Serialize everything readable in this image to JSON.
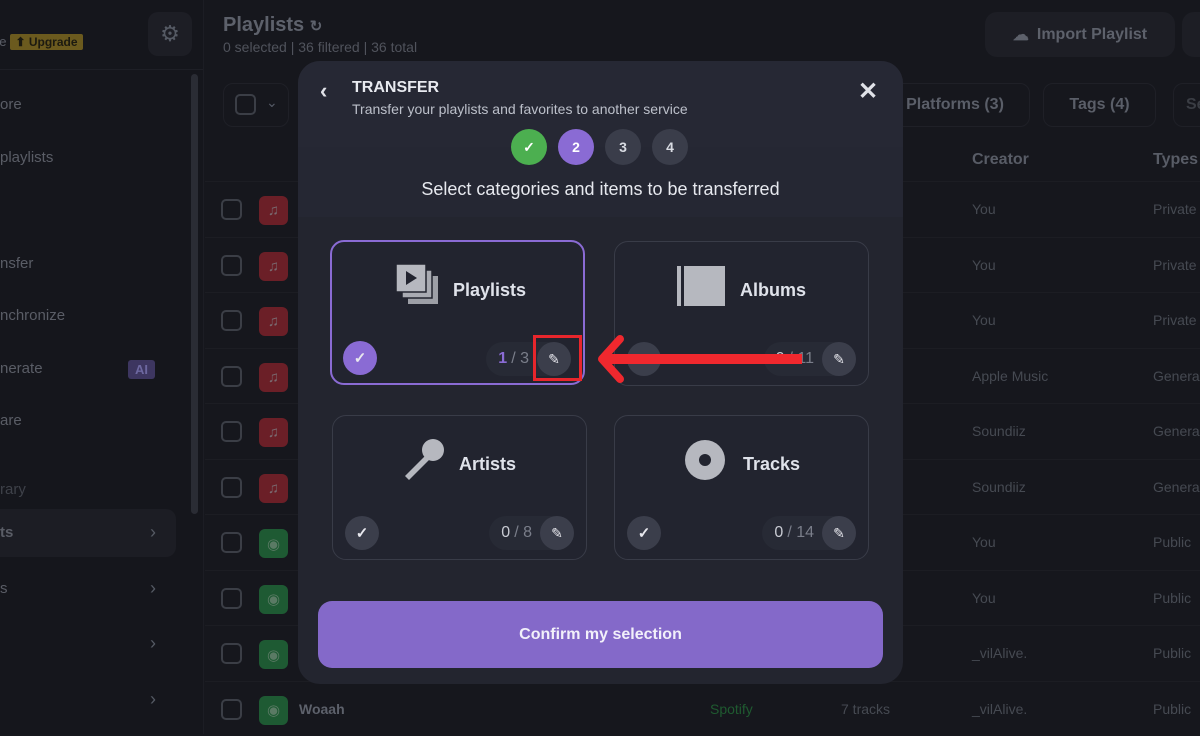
{
  "sidebar": {
    "plan": "ee",
    "upgrade": "Upgrade",
    "items": [
      {
        "label": "ore"
      },
      {
        "label": "playlists"
      },
      {
        "label": "nsfer"
      },
      {
        "label": "nchronize"
      },
      {
        "label": "nerate",
        "badge": "AI"
      },
      {
        "label": "are"
      }
    ],
    "section": "rary",
    "library": [
      {
        "label": "ts"
      },
      {
        "label": "s"
      },
      {
        "label": ""
      },
      {
        "label": ""
      }
    ]
  },
  "header": {
    "title": "Playlists",
    "subtitle": "0 selected | 36 filtered | 36 total",
    "import": "Import Playlist"
  },
  "filters": {
    "platforms": "Platforms (3)",
    "tags": "Tags (4)",
    "search": "Se"
  },
  "table": {
    "columns": {
      "creator": "Creator",
      "types": "Types"
    },
    "rows": [
      {
        "service": "apple",
        "creator": "You",
        "type": "Private"
      },
      {
        "service": "apple",
        "creator": "You",
        "type": "Private"
      },
      {
        "service": "apple",
        "creator": "You",
        "type": "Private"
      },
      {
        "service": "apple",
        "creator": "Apple Music",
        "type": "Genera"
      },
      {
        "service": "apple",
        "creator": "Soundiiz",
        "type": "Genera"
      },
      {
        "service": "apple",
        "creator": "Soundiiz",
        "type": "Genera"
      },
      {
        "service": "spotify",
        "creator": "You",
        "type": "Public"
      },
      {
        "service": "spotify",
        "creator": "You",
        "type": "Public"
      },
      {
        "service": "spotify",
        "creator": "_vilAlive.",
        "type": "Public"
      },
      {
        "service": "spotify",
        "name": "Woaah",
        "platform": "Spotify",
        "tracks": "7 tracks",
        "creator": "_vilAlive.",
        "type": "Public"
      }
    ]
  },
  "modal": {
    "title": "TRANSFER",
    "subtitle": "Transfer your playlists and favorites to another service",
    "steps": [
      "✓",
      "2",
      "3",
      "4"
    ],
    "current_step": 2,
    "question": "Select categories and items to be transferred",
    "cards": [
      {
        "label": "Playlists",
        "selected": "1",
        "total": "3",
        "checked": true
      },
      {
        "label": "Albums",
        "selected": "0",
        "total": "11",
        "checked": false
      },
      {
        "label": "Artists",
        "selected": "0",
        "total": "8",
        "checked": false
      },
      {
        "label": "Tracks",
        "selected": "0",
        "total": "14",
        "checked": false
      }
    ],
    "confirm": "Confirm my selection"
  },
  "colors": {
    "accent": "#8a6bd4",
    "success": "#4caf50",
    "annotation": "#e8262c",
    "apple": "#6b1f27",
    "spotify": "#1e5a33"
  }
}
